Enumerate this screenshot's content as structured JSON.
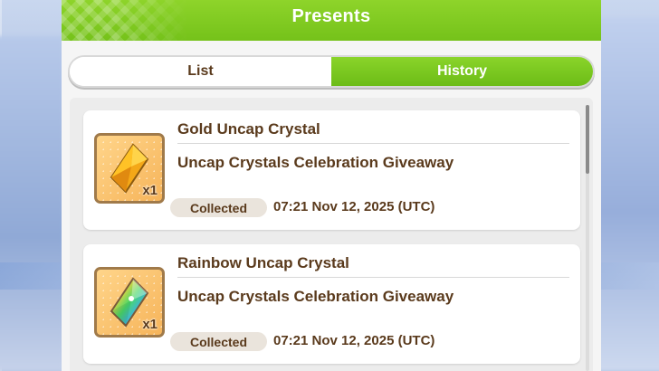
{
  "dialog": {
    "title": "Presents"
  },
  "tabs": [
    {
      "label": "List",
      "selected": false
    },
    {
      "label": "History",
      "selected": true
    }
  ],
  "history": [
    {
      "item_name": "Gold Uncap Crystal",
      "description": "Uncap Crystals Celebration Giveaway",
      "quantity": "x1",
      "status": "Collected",
      "timestamp": "07:21 Nov 12, 2025 (UTC)",
      "icon": "gold-crystal-icon"
    },
    {
      "item_name": "Rainbow Uncap Crystal",
      "description": "Uncap Crystals Celebration Giveaway",
      "quantity": "x1",
      "status": "Collected",
      "timestamp": "07:21 Nov 12, 2025 (UTC)",
      "icon": "rainbow-crystal-icon"
    }
  ],
  "colors": {
    "header_green": "#7ec91f",
    "text_brown": "#5a3a1c",
    "badge_bg": "#eae4dc"
  }
}
